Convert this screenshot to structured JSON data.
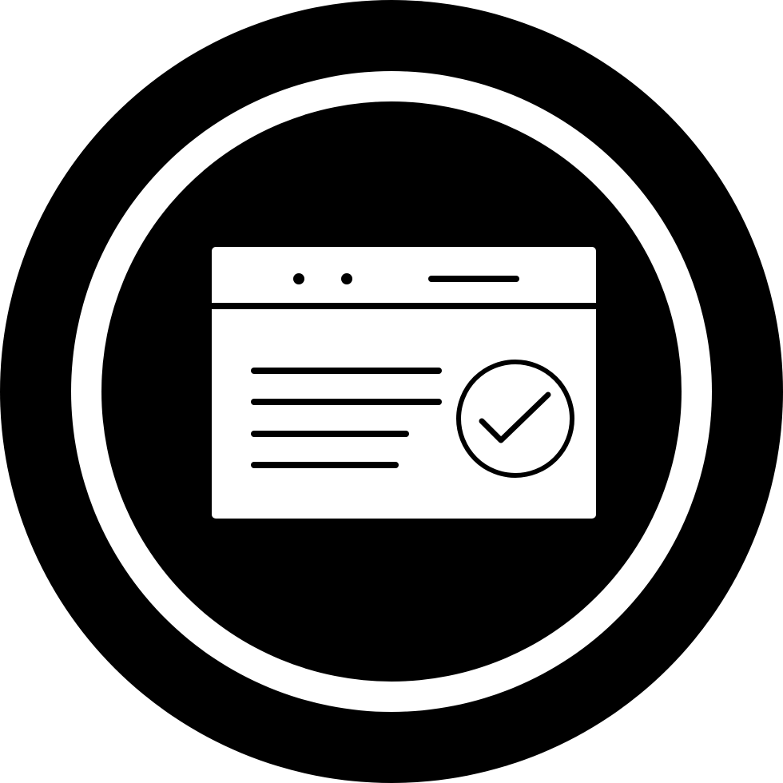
{
  "icon": {
    "name": "browser-check-icon",
    "description_elements": [
      "outer-ring",
      "inner-disc",
      "browser-window",
      "window-dots",
      "address-bar",
      "text-lines",
      "check-badge"
    ]
  },
  "colors": {
    "foreground": "#000000",
    "background": "#ffffff"
  }
}
